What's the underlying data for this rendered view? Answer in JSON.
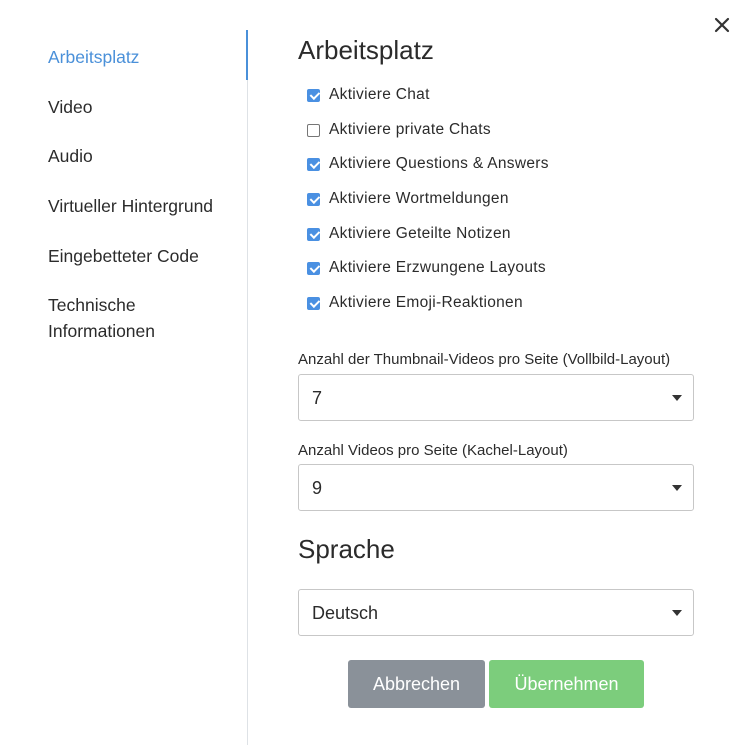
{
  "sidebar": {
    "items": [
      {
        "label": "Arbeitsplatz",
        "active": true
      },
      {
        "label": "Video",
        "active": false
      },
      {
        "label": "Audio",
        "active": false
      },
      {
        "label": "Virtueller Hintergrund",
        "active": false
      },
      {
        "label": "Eingebetteter Code",
        "active": false
      },
      {
        "label": "Technische Informationen",
        "active": false
      }
    ]
  },
  "workspace": {
    "title": "Arbeitsplatz",
    "checkboxes": [
      {
        "label": "Aktiviere Chat",
        "checked": true
      },
      {
        "label": "Aktiviere private Chats",
        "checked": false
      },
      {
        "label": "Aktiviere Questions & Answers",
        "checked": true
      },
      {
        "label": "Aktiviere Wortmeldungen",
        "checked": true
      },
      {
        "label": "Aktiviere Geteilte Notizen",
        "checked": true
      },
      {
        "label": "Aktiviere Erzwungene Layouts",
        "checked": true
      },
      {
        "label": "Aktiviere Emoji-Reaktionen",
        "checked": true
      }
    ],
    "thumbnails_label": "Anzahl der Thumbnail-Videos pro Seite (Vollbild-Layout)",
    "thumbnails_value": "7",
    "tiles_label": "Anzahl Videos pro Seite (Kachel-Layout)",
    "tiles_value": "9"
  },
  "language": {
    "title": "Sprache",
    "value": "Deutsch"
  },
  "buttons": {
    "cancel": "Abbrechen",
    "apply": "Übernehmen"
  },
  "colors": {
    "accent": "#4a90d9",
    "checkbox": "#4a90e2",
    "cancel_button": "#8a9199",
    "apply_button": "#7ccd7c"
  },
  "icons": {
    "close": "close-icon",
    "dropdown": "chevron-down-icon"
  }
}
